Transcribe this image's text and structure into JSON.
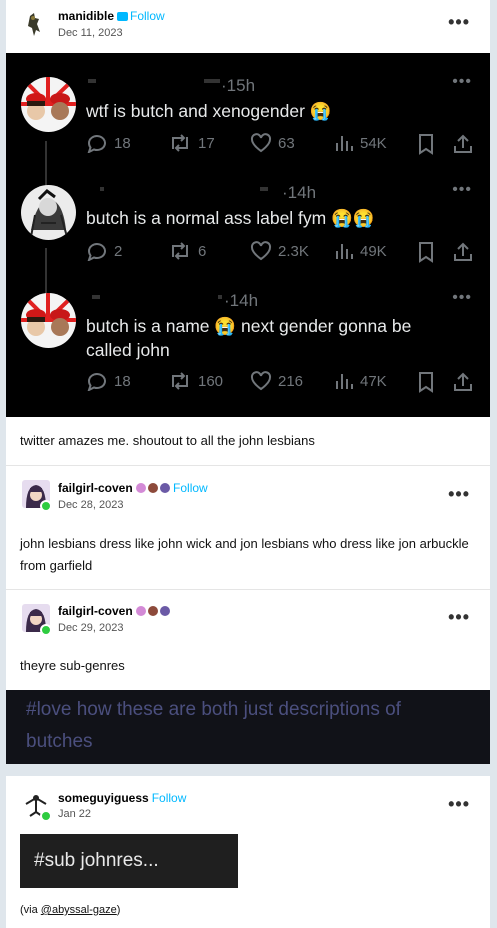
{
  "op_post": {
    "username": "manidible",
    "follow_label": "Follow",
    "date": "Dec 11, 2023",
    "caption": "twitter amazes me. shoutout to all the john lesbians"
  },
  "tweets": [
    {
      "time": "15h",
      "text": "wtf is butch and xenogender 😭",
      "replies": "18",
      "retweets": "17",
      "likes": "63",
      "views": "54K"
    },
    {
      "time": "14h",
      "text": "butch is a normal ass label fym 😭😭",
      "replies": "2",
      "retweets": "6",
      "likes": "2.3K",
      "views": "49K"
    },
    {
      "time": "14h",
      "text": "butch is a name 😭 next gender gonna be called john",
      "replies": "18",
      "retweets": "160",
      "likes": "216",
      "views": "47K"
    }
  ],
  "reblogs": [
    {
      "username": "failgirl-coven",
      "follow_label": "Follow",
      "date": "Dec 28, 2023",
      "text": "john lesbians dress like john wick and jon lesbians who dress like jon arbuckle from garfield"
    },
    {
      "username": "failgirl-coven",
      "date": "Dec 29, 2023",
      "text": "theyre sub-genres"
    }
  ],
  "tags_banner": "#love how these are both just descriptions of butches",
  "last_post": {
    "username": "someguyiguess",
    "follow_label": "Follow",
    "date": "Jan 22",
    "sub_text": "#sub johnres...",
    "via_prefix": "(via ",
    "via_link": "@abyssal-gaze",
    "via_suffix": ")"
  }
}
